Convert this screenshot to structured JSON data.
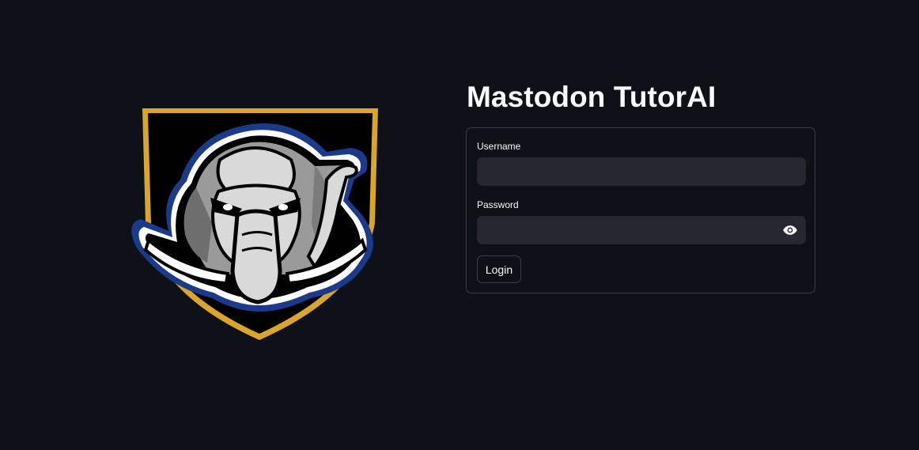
{
  "app": {
    "title": "Mastodon TutorAI"
  },
  "logo": {
    "name": "mastodon-mascot-logo",
    "colors": {
      "shield_border": "#d9a52a",
      "shield_fill": "#000000",
      "outline_blue": "#1c3a8c",
      "head_gray": "#9a9a9a",
      "face_light": "#d9d9d9",
      "tusk": "#ffffff"
    }
  },
  "login_form": {
    "username_label": "Username",
    "username_value": "",
    "password_label": "Password",
    "password_value": "",
    "password_toggle_icon": "eye-icon",
    "submit_label": "Login"
  },
  "theme": {
    "background": "#0e1117",
    "input_bg": "#262730",
    "border": "#3b3e46",
    "text": "#fafafa"
  }
}
